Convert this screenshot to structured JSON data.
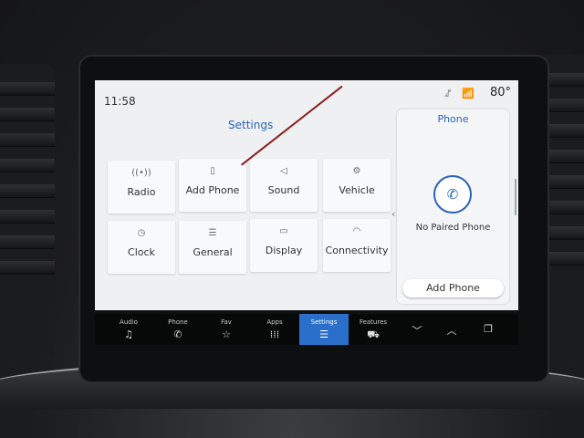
{
  "status": {
    "time": "11:58",
    "temperature": "80°",
    "icons": [
      "mute-icon",
      "signal-icon"
    ]
  },
  "settings": {
    "title": "Settings",
    "tiles": [
      {
        "label": "Radio",
        "icon": "radio-icon"
      },
      {
        "label": "Add Phone",
        "icon": "phone-icon"
      },
      {
        "label": "Sound",
        "icon": "speaker-icon"
      },
      {
        "label": "Vehicle",
        "icon": "vehicle-icon"
      },
      {
        "label": "Clock",
        "icon": "clock-icon"
      },
      {
        "label": "General",
        "icon": "sliders-icon"
      },
      {
        "label": "Display",
        "icon": "display-icon"
      },
      {
        "label": "Connectivity",
        "icon": "wifi-icon"
      }
    ]
  },
  "phone_panel": {
    "title": "Phone",
    "status": "No Paired Phone",
    "button": "Add Phone"
  },
  "nav": [
    {
      "label": "Audio",
      "icon": "music-note-icon"
    },
    {
      "label": "Phone",
      "icon": "phone-icon"
    },
    {
      "label": "Fav",
      "icon": "star-icon"
    },
    {
      "label": "Apps",
      "icon": "apps-grid-icon"
    },
    {
      "label": "Settings",
      "icon": "sliders-icon",
      "active": true
    },
    {
      "label": "Features",
      "icon": "car-icon"
    },
    {
      "label": "",
      "icon": "chevron-down-icon"
    },
    {
      "label": "",
      "icon": "chevron-up-icon"
    },
    {
      "label": "",
      "icon": "copy-icon"
    }
  ],
  "colors": {
    "accent": "#2b62b8",
    "active_tab": "#2a6fc9"
  }
}
